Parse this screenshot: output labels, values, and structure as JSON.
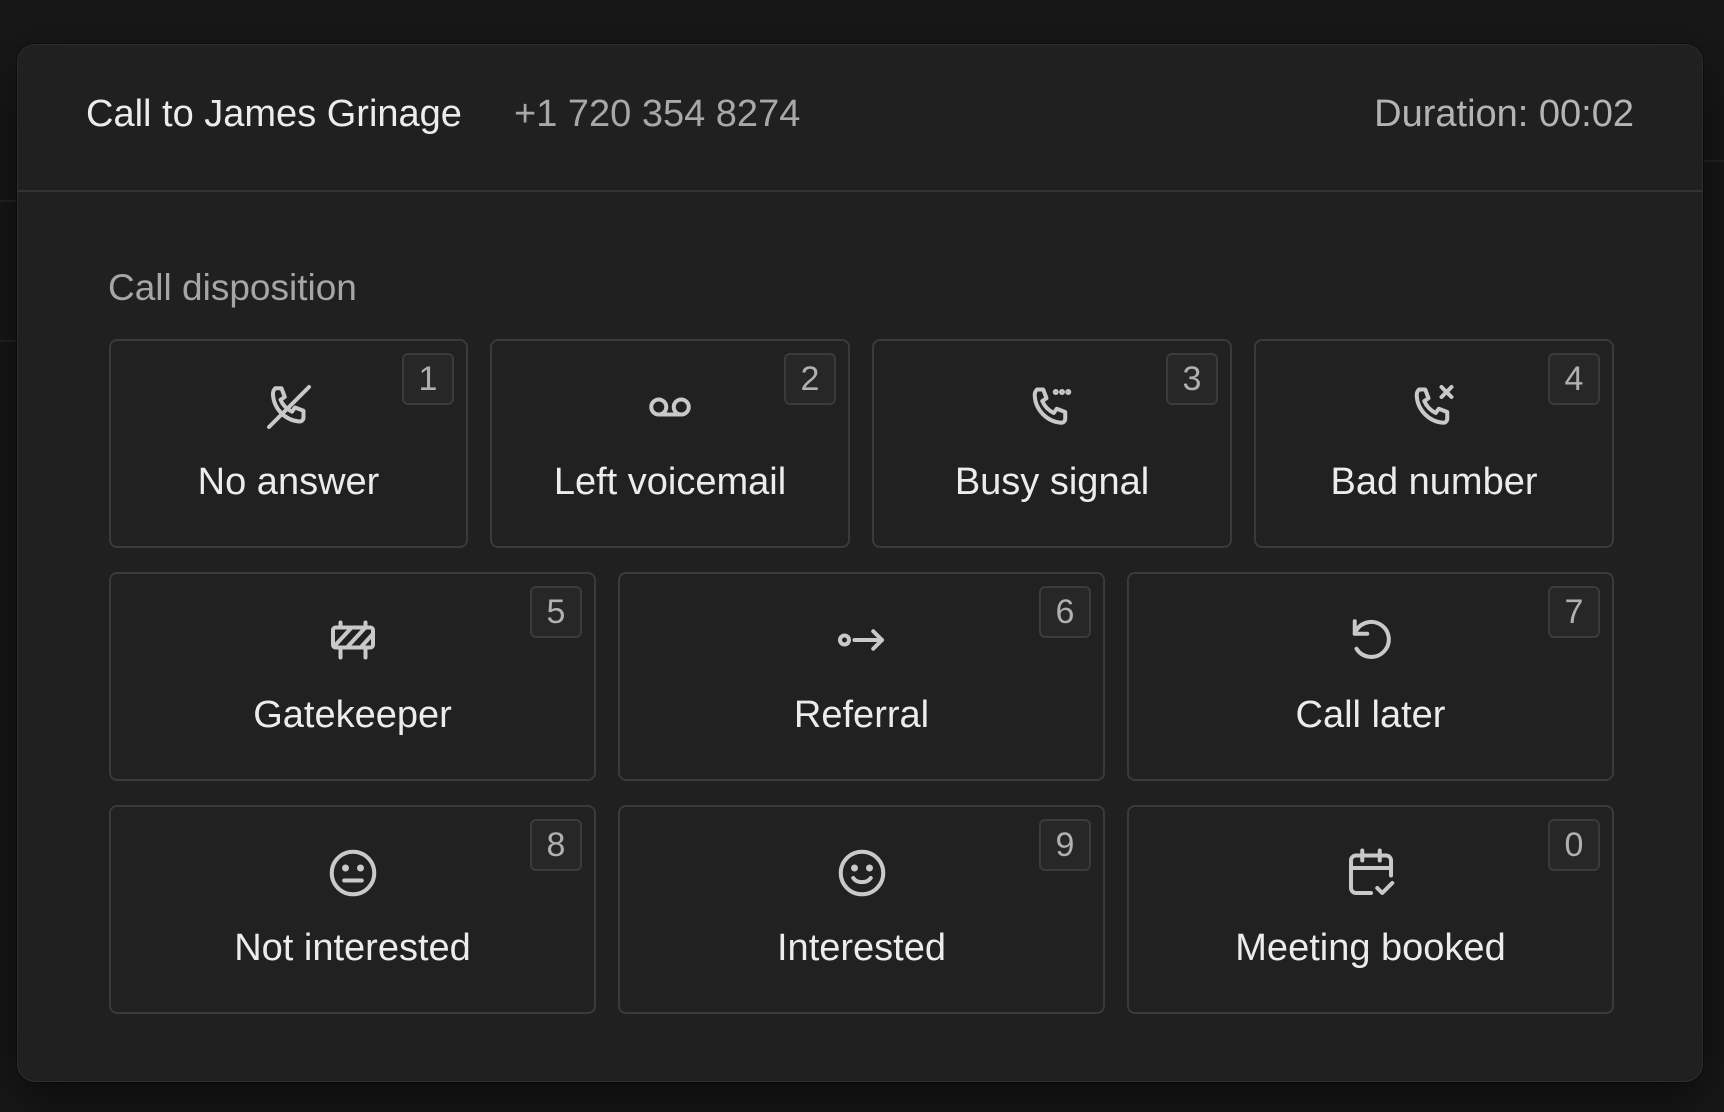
{
  "header": {
    "title": "Call to James Grinage",
    "phone": "+1 720 354 8274",
    "duration": "Duration: 00:02"
  },
  "disposition": {
    "label": "Call disposition",
    "options": [
      {
        "label": "No answer",
        "key": "1",
        "icon": "phone-missed-icon"
      },
      {
        "label": "Left voicemail",
        "key": "2",
        "icon": "voicemail-icon"
      },
      {
        "label": "Busy signal",
        "key": "3",
        "icon": "phone-busy-icon"
      },
      {
        "label": "Bad number",
        "key": "4",
        "icon": "phone-x-icon"
      },
      {
        "label": "Gatekeeper",
        "key": "5",
        "icon": "barrier-icon"
      },
      {
        "label": "Referral",
        "key": "6",
        "icon": "referral-arrow-icon"
      },
      {
        "label": "Call later",
        "key": "7",
        "icon": "rotate-icon"
      },
      {
        "label": "Not interested",
        "key": "8",
        "icon": "neutral-face-icon"
      },
      {
        "label": "Interested",
        "key": "9",
        "icon": "smile-face-icon"
      },
      {
        "label": "Meeting booked",
        "key": "0",
        "icon": "calendar-check-icon"
      }
    ]
  }
}
